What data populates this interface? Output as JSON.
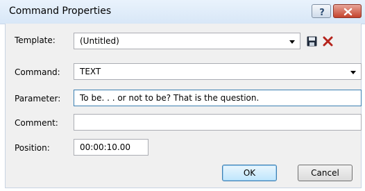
{
  "window": {
    "title": "Command Properties"
  },
  "template": {
    "label": "Template:",
    "value": "(Untitled)",
    "save_icon": "floppy-disk-icon",
    "delete_icon": "red-x-icon"
  },
  "command": {
    "label": "Command:",
    "value": "TEXT"
  },
  "parameter": {
    "label": "Parameter:",
    "value": "To be. . . or not to be? That is the question."
  },
  "comment": {
    "label": "Comment:",
    "value": ""
  },
  "position": {
    "label": "Position:",
    "value": "00:00:10.00"
  },
  "buttons": {
    "ok": "OK",
    "cancel": "Cancel"
  },
  "colors": {
    "close_button": "#c4432c",
    "active_border": "#3c7fb1"
  }
}
